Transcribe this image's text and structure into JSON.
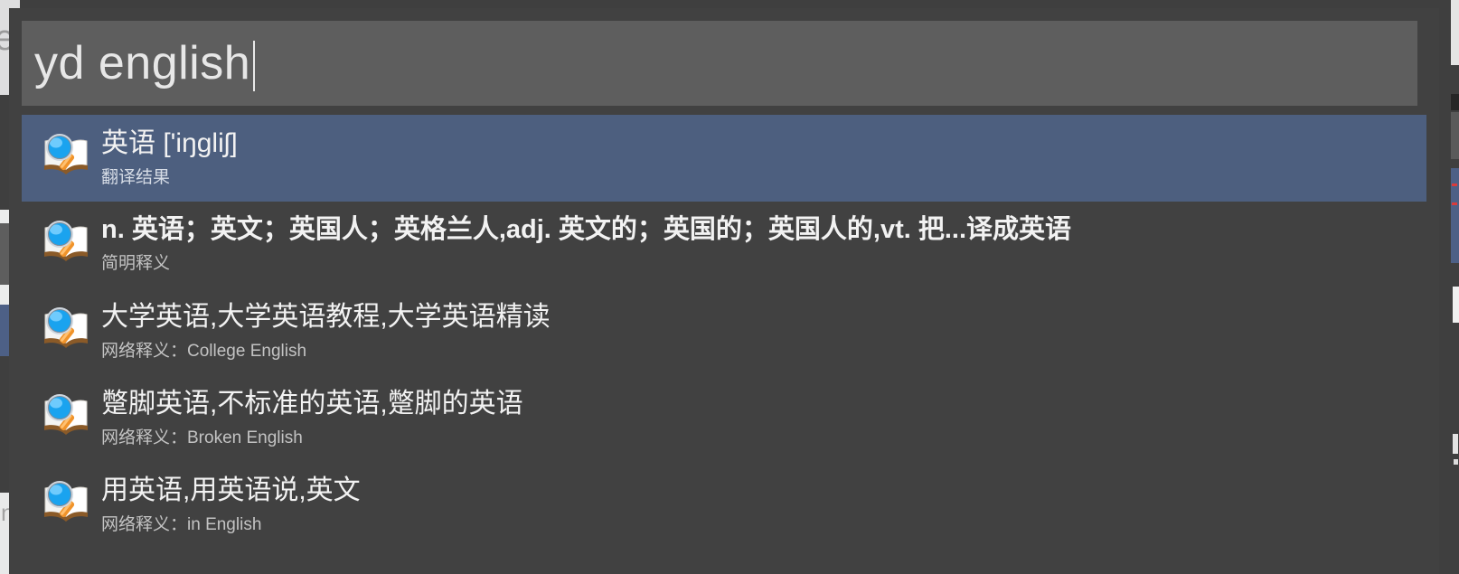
{
  "window": {
    "app_name": "Youdao Dictionary quick search popup",
    "background_color": "#414141",
    "highlight_color": "#4d5f7f",
    "search_field_color": "#5e5e5e"
  },
  "search": {
    "value": "yd english",
    "placeholder": "",
    "caret_visible": true
  },
  "background": {
    "left_glyph_top": "e",
    "left_glyph_bottom": "n"
  },
  "results": [
    {
      "icon": "dictionary-search-icon",
      "title": "英语 ['iŋgliʃ]",
      "subtitle": "翻译结果",
      "selected": true,
      "bold": false
    },
    {
      "icon": "dictionary-search-icon",
      "title": "n. 英语；英文；英国人；英格兰人,adj. 英文的；英国的；英国人的,vt. 把...译成英语",
      "subtitle": "简明释义",
      "selected": false,
      "bold": true
    },
    {
      "icon": "dictionary-search-icon",
      "title": "大学英语,大学英语教程,大学英语精读",
      "subtitle": "网络释义：College English",
      "selected": false,
      "bold": false
    },
    {
      "icon": "dictionary-search-icon",
      "title": "蹩脚英语,不标准的英语,蹩脚的英语",
      "subtitle": "网络释义：Broken English",
      "selected": false,
      "bold": false
    },
    {
      "icon": "dictionary-search-icon",
      "title": "用英语,用英语说,英文",
      "subtitle": "网络释义：in English",
      "selected": false,
      "bold": false
    }
  ]
}
